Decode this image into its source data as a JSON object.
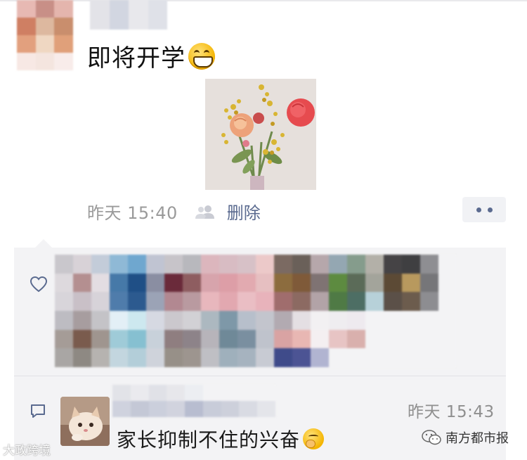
{
  "post": {
    "text": "即将开学",
    "emoji_icon": "grinning-face-icon",
    "time": "昨天 15:40",
    "delete_label": "删除",
    "visibility_icon": "people-icon",
    "more_icon": "more-dots-icon"
  },
  "likes": {
    "icon": "heart-icon"
  },
  "comment": {
    "icon": "comment-icon",
    "time": "昨天 15:43",
    "text": "家长抑制不住的兴奋",
    "emoji_icon": "thinking-face-icon"
  },
  "watermarks": {
    "left": "大政跨境",
    "right": "南方都市报"
  },
  "colors": {
    "link": "#5a6a8f",
    "panel": "#f3f3f5",
    "time": "#8f8f8f"
  }
}
